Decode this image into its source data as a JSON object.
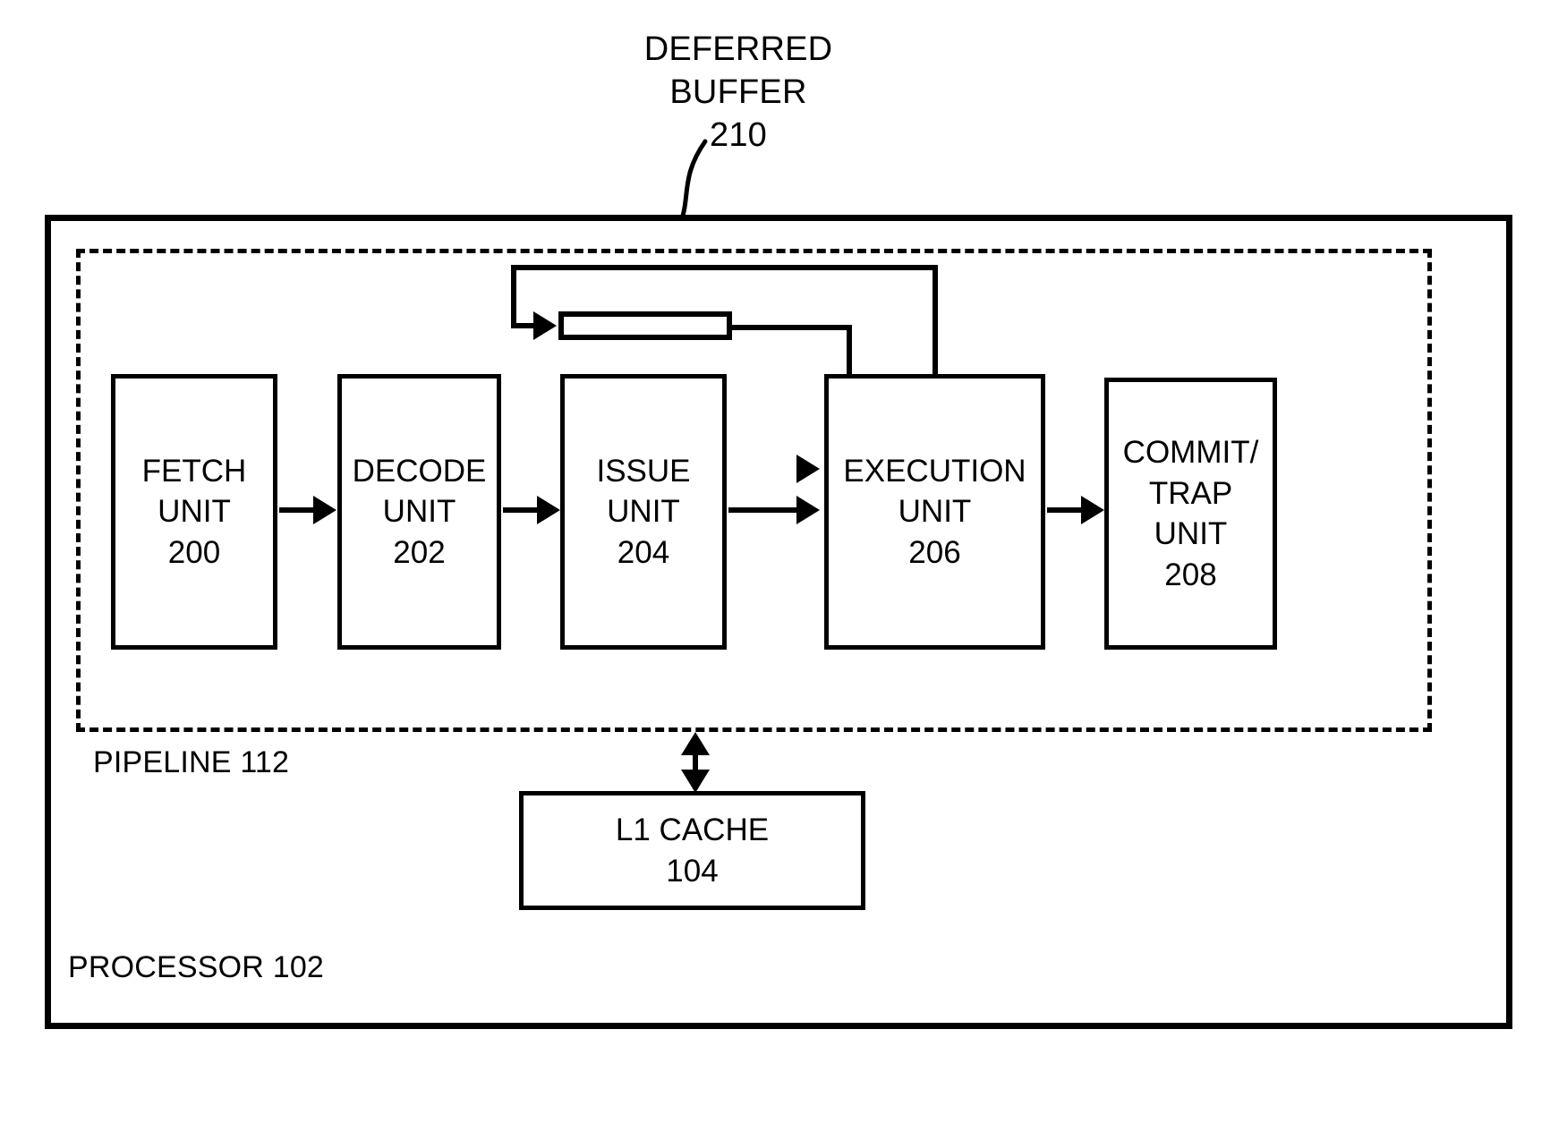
{
  "diagram": {
    "title_callout": "DEFERRED\nBUFFER\n210",
    "outer_block": {
      "label": "PROCESSOR 102"
    },
    "dashed_block": {
      "label": "PIPELINE 112"
    },
    "stages": [
      {
        "id": "fetch",
        "label": "FETCH\nUNIT\n200"
      },
      {
        "id": "decode",
        "label": "DECODE\nUNIT\n202"
      },
      {
        "id": "issue",
        "label": "ISSUE\nUNIT\n204"
      },
      {
        "id": "execution",
        "label": "EXECUTION\nUNIT\n206"
      },
      {
        "id": "commit",
        "label": "COMMIT/\nTRAP\nUNIT\n208"
      }
    ],
    "deferred_buffer": {
      "label": "",
      "reference_numeral": "210"
    },
    "cache": {
      "label": "L1 CACHE\n104"
    },
    "connections": [
      {
        "from": "fetch",
        "to": "decode",
        "kind": "arrow-right"
      },
      {
        "from": "decode",
        "to": "issue",
        "kind": "arrow-right"
      },
      {
        "from": "issue",
        "to": "execution",
        "kind": "arrow-right"
      },
      {
        "from": "execution",
        "to": "commit",
        "kind": "arrow-right"
      },
      {
        "from": "execution",
        "to": "deferred-buffer",
        "kind": "feedback-loop"
      },
      {
        "from": "deferred-buffer",
        "to": "execution",
        "kind": "arrow-right"
      },
      {
        "from": "pipeline",
        "to": "l1-cache",
        "kind": "double-arrow"
      }
    ]
  },
  "colors": {
    "ink": "#000000",
    "paper": "#ffffff"
  }
}
